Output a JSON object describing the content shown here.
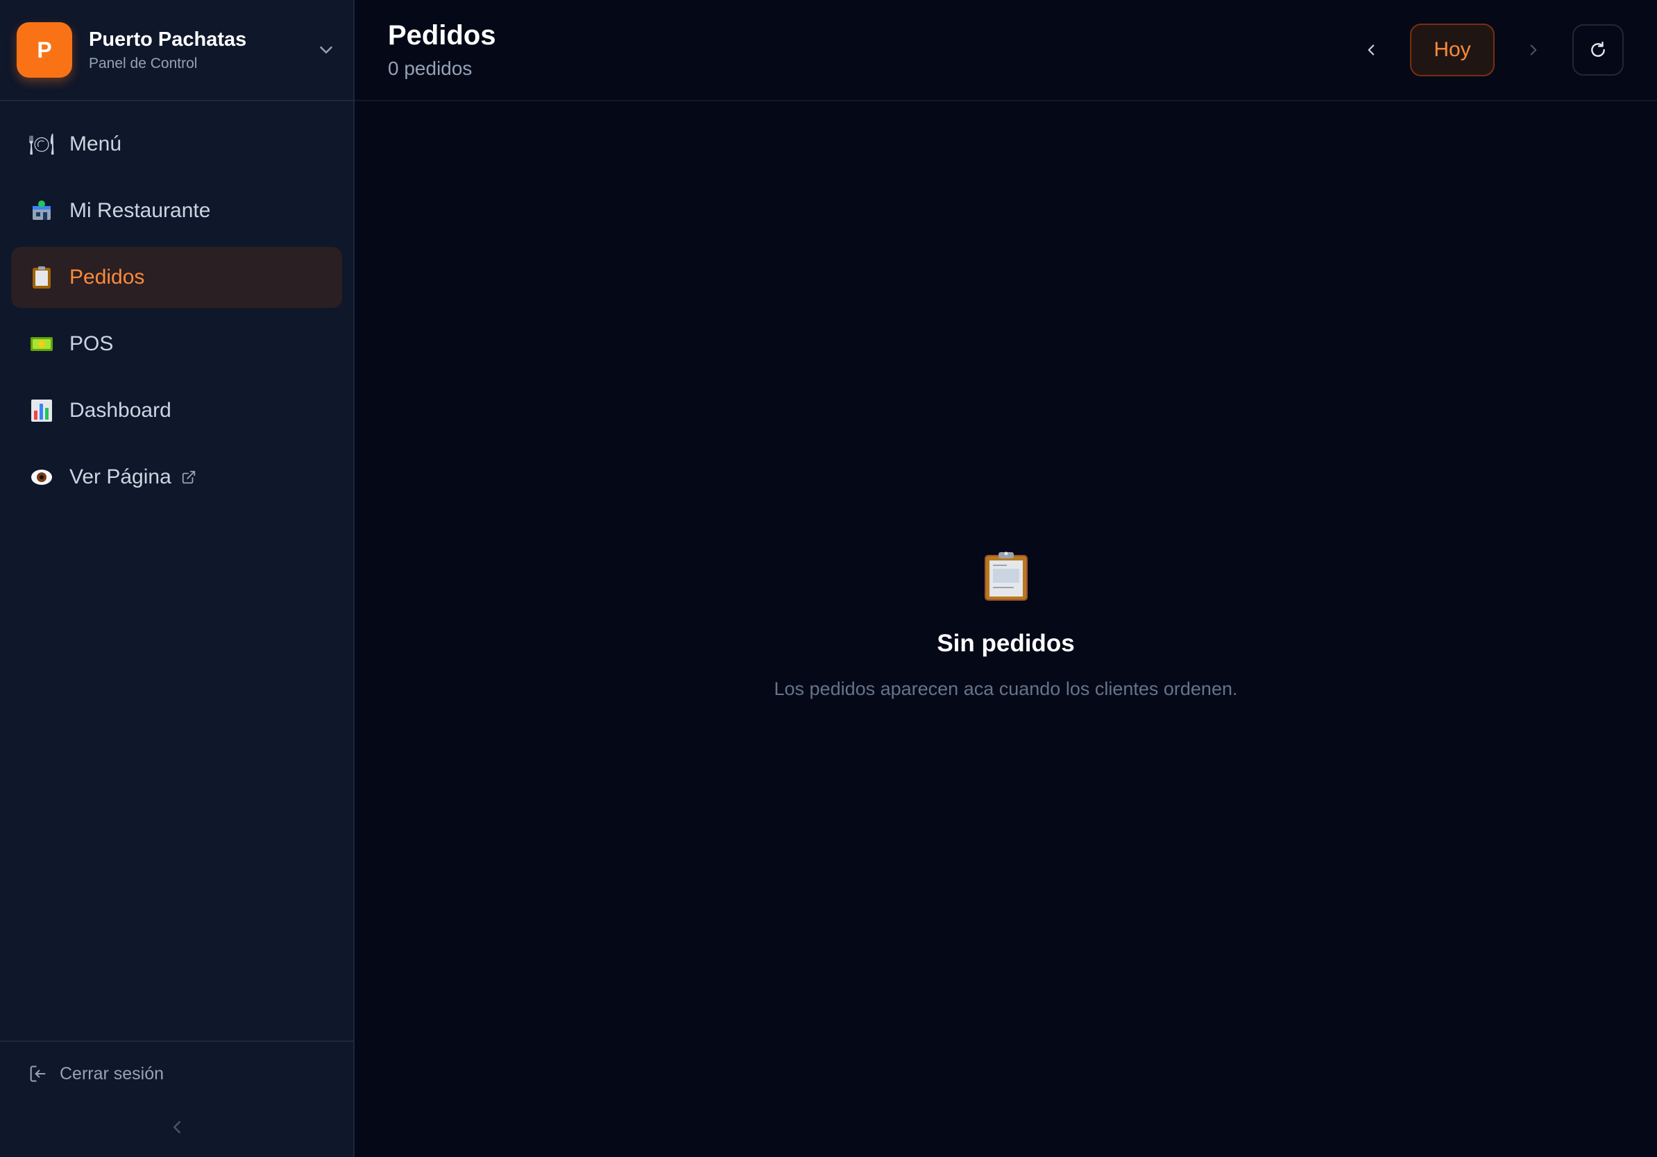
{
  "brand": {
    "initial": "P",
    "name": "Puerto Pachatas",
    "subtitle": "Panel de Control"
  },
  "sidebar": {
    "items": [
      {
        "label": "Menú",
        "icon": "plate-cutlery-icon",
        "active": false
      },
      {
        "label": "Mi Restaurante",
        "icon": "restaurant-building-icon",
        "active": false
      },
      {
        "label": "Pedidos",
        "icon": "clipboard-icon",
        "active": true
      },
      {
        "label": "POS",
        "icon": "money-bill-icon",
        "active": false
      },
      {
        "label": "Dashboard",
        "icon": "bar-chart-icon",
        "active": false
      },
      {
        "label": "Ver Página",
        "icon": "eye-icon",
        "active": false,
        "external": true
      }
    ],
    "logout_label": "Cerrar sesión"
  },
  "header": {
    "title": "Pedidos",
    "count": "0 pedidos",
    "today_label": "Hoy"
  },
  "empty_state": {
    "title": "Sin pedidos",
    "description": "Los pedidos aparecen aca cuando los clientes ordenen."
  },
  "colors": {
    "accent": "#f97316",
    "background": "#050816",
    "sidebar": "#0f172a"
  }
}
